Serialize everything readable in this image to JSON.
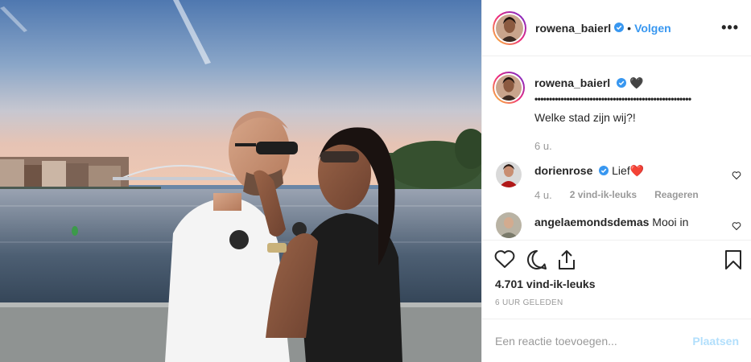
{
  "post": {
    "author": "rowena_baierl",
    "dot": "•",
    "follow_label": "Volgen",
    "more_label": "•••",
    "caption": {
      "username": "rowena_baierl",
      "emoji": "🖤",
      "dots": "••••••••••••••••••••••••••••••••••••••••••••••••••••••",
      "text": "Welke stad zijn wij?!",
      "time": "6 u."
    },
    "comments": [
      {
        "username": "dorienrose",
        "text": "Lief",
        "emoji": "❤️",
        "time": "4 u.",
        "likes": "2 vind-ik-leuks",
        "reply": "Reageren"
      },
      {
        "username": "angelaemondsdemas",
        "text": "Mooi in"
      }
    ],
    "like_count": "4.701 vind-ik-leuks",
    "posted_ago": "6 UUR GELEDEN",
    "comment_placeholder": "Een reactie toevoegen...",
    "post_button": "Plaatsen"
  },
  "colors": {
    "accent": "#3897f0",
    "verified": "#3897f0",
    "post_disabled": "#b2dffc"
  },
  "icons": [
    "verified-badge-icon",
    "heart-icon",
    "comment-icon",
    "share-icon",
    "bookmark-icon",
    "more-icon"
  ]
}
